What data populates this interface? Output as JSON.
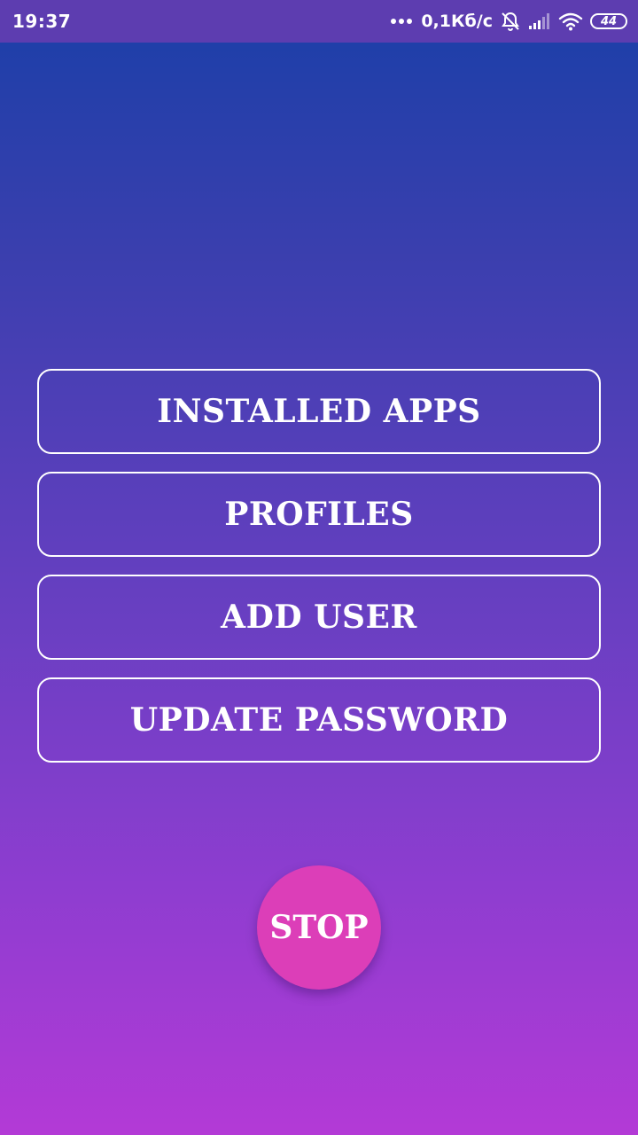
{
  "status_bar": {
    "time": "19:37",
    "network_speed": "0,1Кб/с",
    "battery_level": "44",
    "icons": [
      "more-dots-icon",
      "alarm-off-icon",
      "signal-icon",
      "wifi-icon",
      "battery-icon"
    ]
  },
  "menu": {
    "items": [
      {
        "label": "INSTALLED APPS"
      },
      {
        "label": "PROFILES"
      },
      {
        "label": "ADD USER"
      },
      {
        "label": "UPDATE PASSWORD"
      }
    ]
  },
  "stop": {
    "label": "STOP"
  },
  "colors": {
    "status_bar": "#5d3db0",
    "gradient_top": "#1a3fa8",
    "gradient_bottom": "#b33ad6",
    "stop_button": "#dc3eb8",
    "button_border": "#ffffff"
  }
}
